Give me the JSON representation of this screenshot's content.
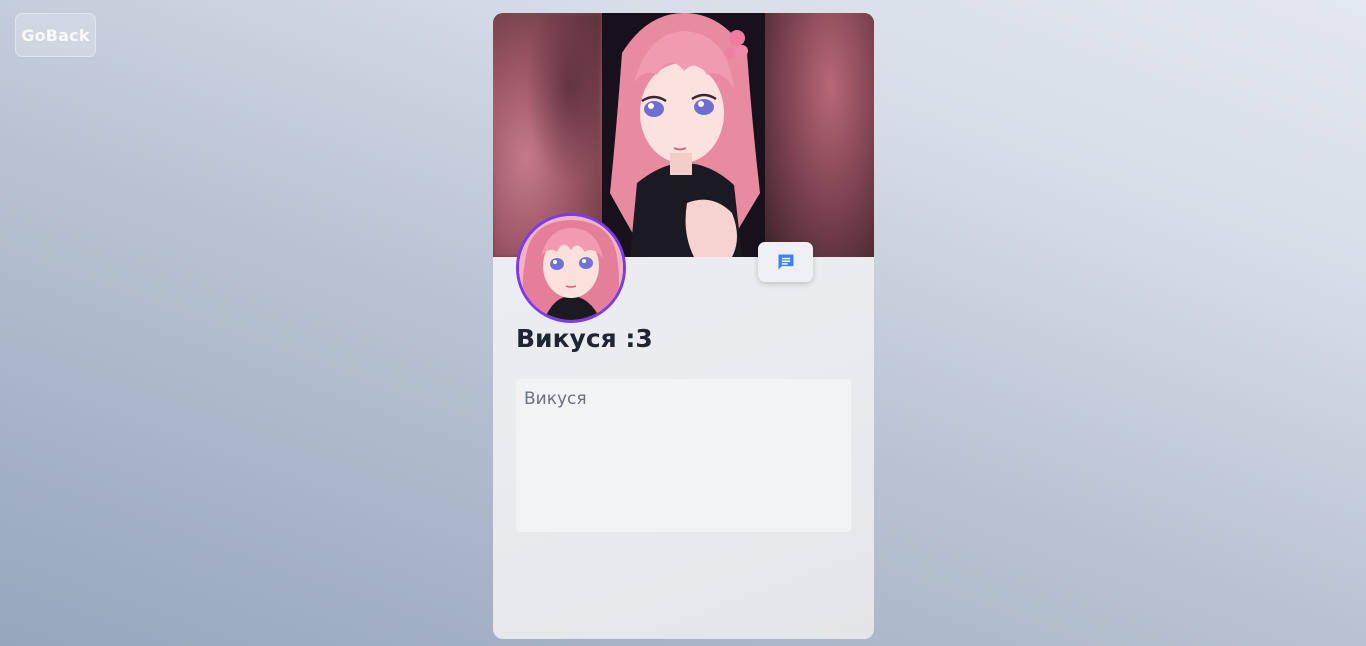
{
  "nav": {
    "back_label": "GoBack"
  },
  "profile": {
    "name": "Викуся :3",
    "bio": "Викуся",
    "chat_icon": "chat-icon",
    "avatar_ring_color": "#7c3aed",
    "chat_icon_color": "#3b82f6"
  }
}
